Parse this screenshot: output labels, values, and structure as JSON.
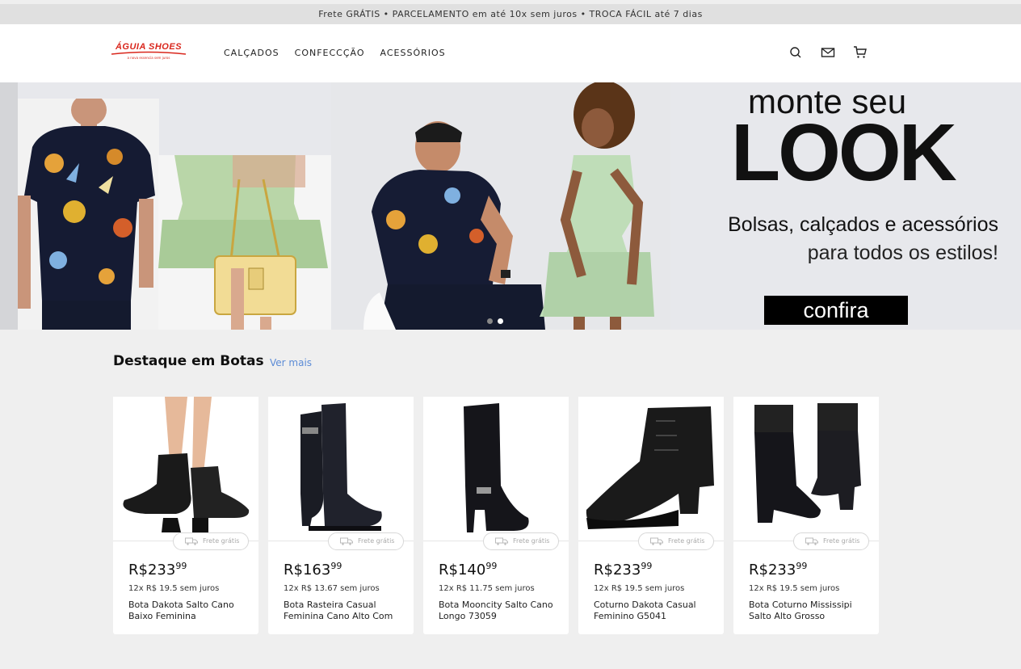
{
  "topbar": {
    "text": "Frete GRÁTIS • PARCELAMENTO em até 10x sem juros • TROCA FÁCIL  até 7 dias"
  },
  "brand": {
    "name": "ÁGUIA SHOES",
    "tagline": "a nova essencia sem juros",
    "color": "#d9261c"
  },
  "nav": [
    {
      "label": "CALÇADOS"
    },
    {
      "label": "CONFECCÇÃO"
    },
    {
      "label": "ACESSÓRIOS"
    }
  ],
  "header_icons": [
    "search-icon",
    "mail-icon",
    "cart-icon"
  ],
  "hero": {
    "title_line1": "monte seu",
    "title_line2": "LOOK",
    "subtitle_line1": "Bolsas, calçados e acessórios",
    "subtitle_line2": "para todos os estilos!",
    "cta": "confira",
    "slide_count": 2,
    "active_slide": 2
  },
  "section": {
    "title": "Destaque em Botas",
    "link": "Ver mais"
  },
  "products": [
    {
      "price_main": "R$233",
      "price_cents": "99",
      "installments": "12x R$ 19.5 sem juros",
      "name": "Bota Dakota Salto Cano Baixo Feminina",
      "shipping": "Frete grátis"
    },
    {
      "price_main": "R$163",
      "price_cents": "99",
      "installments": "12x R$ 13.67 sem juros",
      "name": "Bota Rasteira Casual Feminina Cano Alto Com",
      "shipping": "Frete grátis"
    },
    {
      "price_main": "R$140",
      "price_cents": "99",
      "installments": "12x R$ 11.75 sem juros",
      "name": "Bota Mooncity Salto Cano Longo 73059",
      "shipping": "Frete grátis"
    },
    {
      "price_main": "R$233",
      "price_cents": "99",
      "installments": "12x R$ 19.5 sem juros",
      "name": "Coturno Dakota Casual Feminino G5041",
      "shipping": "Frete grátis"
    },
    {
      "price_main": "R$233",
      "price_cents": "99",
      "installments": "12x R$ 19.5 sem juros",
      "name": "Bota Coturno Mississipi Salto Alto Grosso",
      "shipping": "Frete grátis"
    }
  ]
}
